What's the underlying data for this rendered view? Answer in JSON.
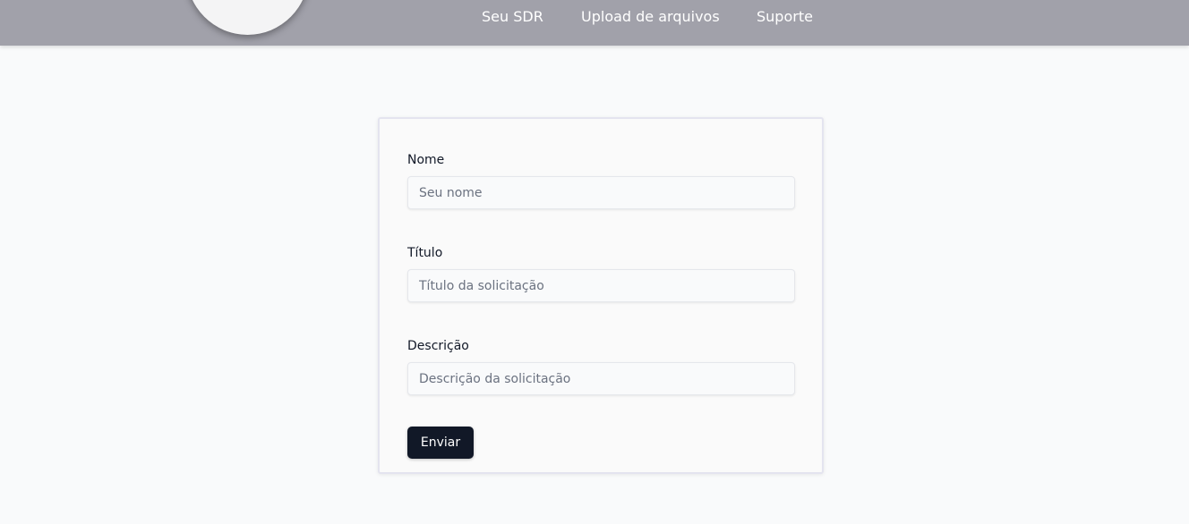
{
  "nav": {
    "links": [
      "Seu SDR",
      "Upload de arquivos",
      "Suporte"
    ]
  },
  "form": {
    "nome": {
      "label": "Nome",
      "placeholder": "Seu nome",
      "value": ""
    },
    "titulo": {
      "label": "Título",
      "placeholder": "Título da solicitação",
      "value": ""
    },
    "descricao": {
      "label": "Descrição",
      "placeholder": "Descrição da solicitação",
      "value": ""
    },
    "submit_label": "Enviar"
  },
  "colors": {
    "navbar_bg": "#a1a1aa",
    "button_bg": "#111827",
    "page_bg": "#f9fafb"
  }
}
